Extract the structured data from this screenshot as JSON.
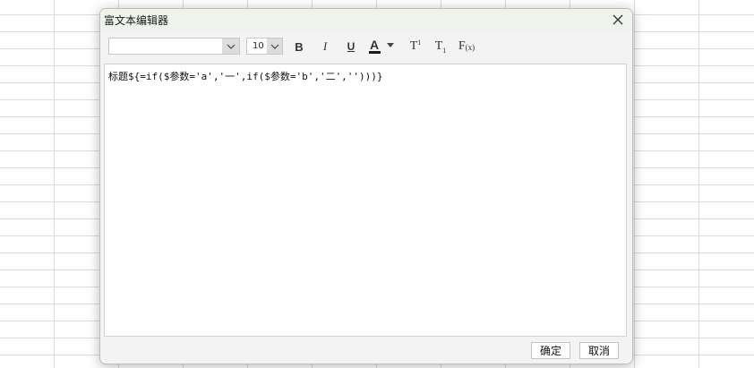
{
  "dialog": {
    "title": "富文本编辑器",
    "close_icon": "close-icon"
  },
  "toolbar": {
    "font_family_value": "",
    "font_size_value": "10",
    "bold_label": "B",
    "italic_label": "I",
    "underline_label": "U",
    "font_color_label": "A",
    "font_color": "#1a1a1a",
    "superscript_label": "T",
    "superscript_mark": "1",
    "subscript_label": "T",
    "subscript_mark": "1",
    "formula_label": "F",
    "formula_mark": "(x)"
  },
  "editor": {
    "content": "标题${=if($参数='a','一',if($参数='b','二','')))}"
  },
  "footer": {
    "ok_label": "确定",
    "cancel_label": "取消"
  }
}
